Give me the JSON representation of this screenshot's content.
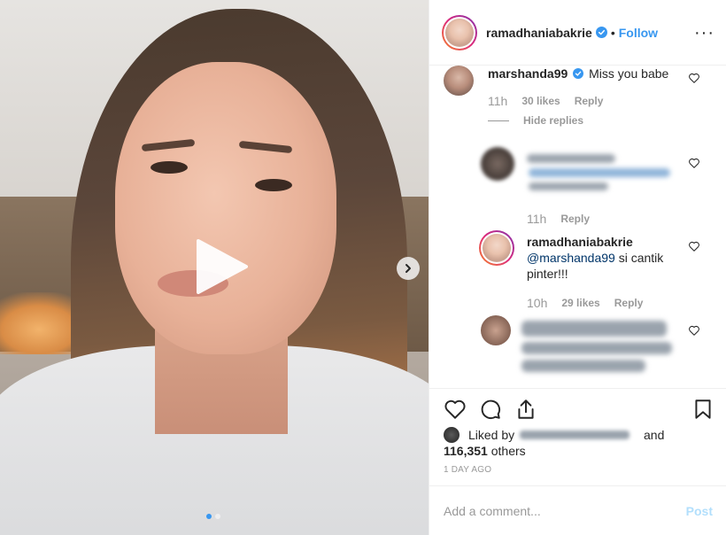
{
  "post": {
    "username": "ramadhaniabakrie",
    "separator": "•",
    "follow_label": "Follow",
    "more_label": "···"
  },
  "comments": [
    {
      "username": "marshanda99",
      "text": "Miss you babe",
      "time": "11h",
      "likes": "30 likes",
      "reply_label": "Reply",
      "hide_replies_label": "Hide replies"
    }
  ],
  "replies": [
    {
      "username": "",
      "text": "",
      "time": "11h",
      "reply_label": "Reply",
      "redacted": true
    },
    {
      "username": "ramadhaniabakrie",
      "mention": "@marshanda99",
      "text": " si cantik pinter!!!",
      "time": "10h",
      "likes": "29 likes",
      "reply_label": "Reply"
    },
    {
      "username": "",
      "text": "",
      "redacted": true
    }
  ],
  "likes": {
    "prefix": "Liked by",
    "and": "and",
    "count": "116,351",
    "others": " others"
  },
  "timestamp": "1 DAY AGO",
  "composer": {
    "placeholder": "Add a comment...",
    "post_label": "Post"
  },
  "colors": {
    "accent": "#3897f0",
    "post_disabled": "#b2dffc",
    "muted": "#999999"
  },
  "icons": [
    "play-icon",
    "chevron-right-icon",
    "verified-icon",
    "more-icon",
    "heart-icon",
    "comment-icon",
    "share-icon",
    "bookmark-icon"
  ]
}
